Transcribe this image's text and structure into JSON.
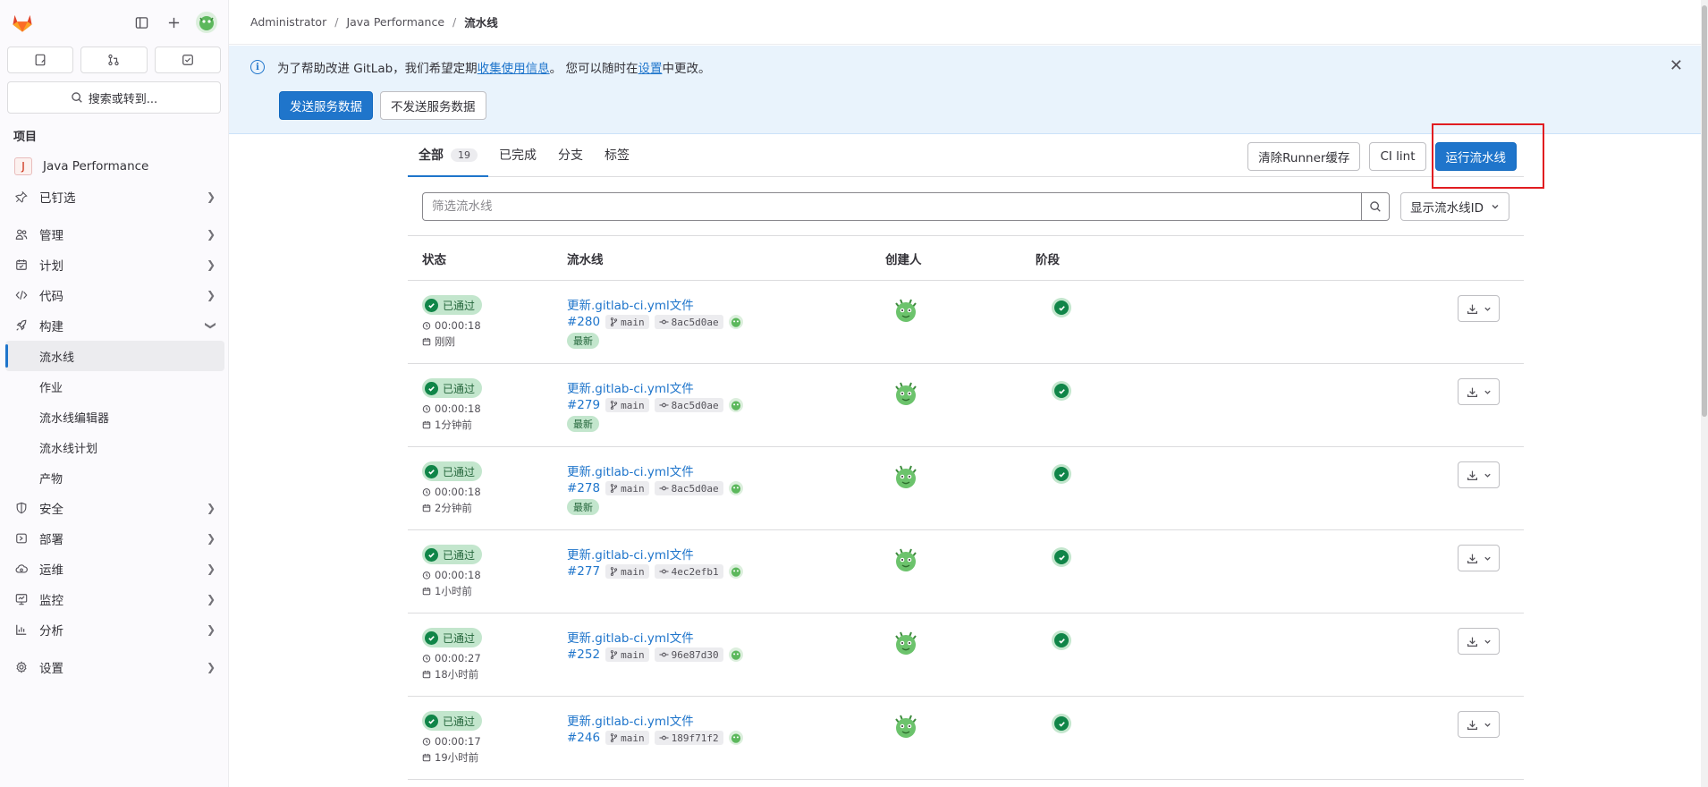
{
  "breadcrumb": [
    "Administrator",
    "Java Performance",
    "流水线"
  ],
  "sidebar": {
    "search_label": "搜索或转到...",
    "section_title": "项目",
    "project": {
      "initial": "J",
      "name": "Java Performance"
    },
    "items": [
      {
        "label": "已钉选",
        "icon": "pin-icon"
      },
      {
        "label": "管理",
        "icon": "users-icon"
      },
      {
        "label": "计划",
        "icon": "calendar-icon"
      },
      {
        "label": "代码",
        "icon": "code-icon"
      },
      {
        "label": "构建",
        "icon": "rocket-icon"
      }
    ],
    "build_sub": [
      "流水线",
      "作业",
      "流水线编辑器",
      "流水线计划",
      "产物"
    ],
    "items_after": [
      {
        "label": "安全",
        "icon": "shield-icon"
      },
      {
        "label": "部署",
        "icon": "deploy-icon"
      },
      {
        "label": "运维",
        "icon": "cloud-icon"
      },
      {
        "label": "监控",
        "icon": "monitor-icon"
      },
      {
        "label": "分析",
        "icon": "chart-icon"
      }
    ],
    "settings_label": "设置"
  },
  "banner": {
    "text_prefix": "为了帮助改进 GitLab，我们希望定期",
    "link1": "收集使用信息",
    "text_mid": "。 您可以随时在",
    "link2": "设置",
    "text_suffix": "中更改。",
    "send_label": "发送服务数据",
    "dont_send_label": "不发送服务数据"
  },
  "tabs": {
    "all": "全部",
    "all_count": "19",
    "finished": "已完成",
    "branches": "分支",
    "tags": "标签"
  },
  "actions": {
    "clear_cache": "清除Runner缓存",
    "ci_lint": "CI lint",
    "run_pipeline": "运行流水线"
  },
  "filter": {
    "placeholder": "筛选流水线",
    "id_dropdown": "显示流水线ID"
  },
  "table": {
    "headers": {
      "status": "状态",
      "pipeline": "流水线",
      "creator": "创建人",
      "stage": "阶段"
    },
    "status_label": "已通过",
    "latest_label": "最新",
    "rows": [
      {
        "title": "更新.gitlab-ci.yml文件",
        "id": "#280",
        "branch": "main",
        "commit": "8ac5d0ae",
        "duration": "00:00:18",
        "time": "刚刚",
        "latest": true
      },
      {
        "title": "更新.gitlab-ci.yml文件",
        "id": "#279",
        "branch": "main",
        "commit": "8ac5d0ae",
        "duration": "00:00:18",
        "time": "1分钟前",
        "latest": true
      },
      {
        "title": "更新.gitlab-ci.yml文件",
        "id": "#278",
        "branch": "main",
        "commit": "8ac5d0ae",
        "duration": "00:00:18",
        "time": "2分钟前",
        "latest": true
      },
      {
        "title": "更新.gitlab-ci.yml文件",
        "id": "#277",
        "branch": "main",
        "commit": "4ec2efb1",
        "duration": "00:00:18",
        "time": "1小时前",
        "latest": false
      },
      {
        "title": "更新.gitlab-ci.yml文件",
        "id": "#252",
        "branch": "main",
        "commit": "96e87d30",
        "duration": "00:00:27",
        "time": "18小时前",
        "latest": false
      },
      {
        "title": "更新.gitlab-ci.yml文件",
        "id": "#246",
        "branch": "main",
        "commit": "189f71f2",
        "duration": "00:00:17",
        "time": "19小时前",
        "latest": false
      }
    ]
  }
}
